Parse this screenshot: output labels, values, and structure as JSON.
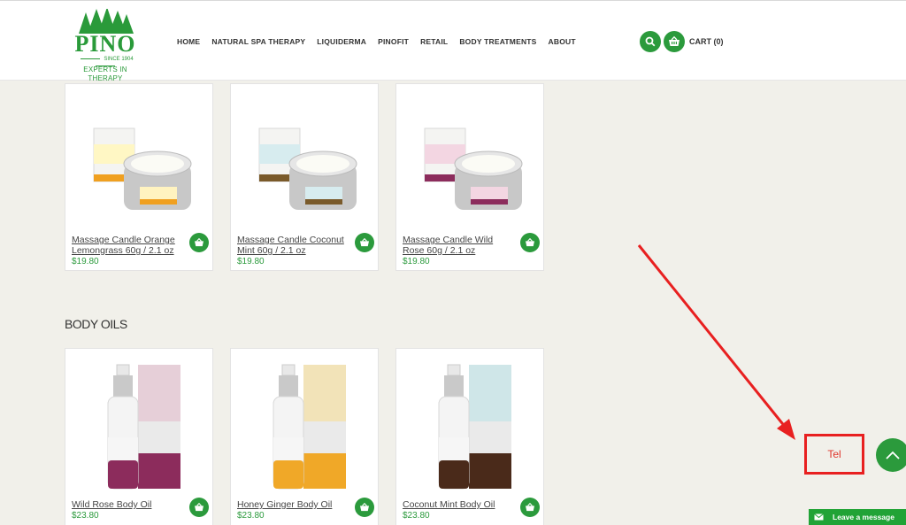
{
  "brand": {
    "name": "PINO",
    "since": "SINCE 1904",
    "tagline": "EXPERTS IN THERAPY",
    "accent_color": "#2b9a3c"
  },
  "nav": {
    "items": [
      "HOME",
      "NATURAL SPA THERAPY",
      "LIQUIDERMA",
      "PINOFIT",
      "RETAIL",
      "BODY TREATMENTS",
      "ABOUT"
    ]
  },
  "header": {
    "cart_label": "CART (0)",
    "search_icon": "search-icon",
    "cart_icon": "cart-icon"
  },
  "candles": [
    {
      "title": "Massage Candle Orange Lemongrass 60g / 2.1 oz",
      "price": "$19.80",
      "accent": "#f0a020"
    },
    {
      "title": "Massage Candle Coconut Mint 60g / 2.1 oz",
      "price": "$19.80",
      "accent": "#7a5a2a"
    },
    {
      "title": "Massage Candle Wild Rose 60g / 2.1 oz",
      "price": "$19.80",
      "accent": "#8c2c5c"
    }
  ],
  "body_oils": {
    "heading": "BODY OILS",
    "items": [
      {
        "title": "Wild Rose Body Oil",
        "price": "$23.80",
        "accent": "#8c2c5c",
        "box": "#e6cfd8"
      },
      {
        "title": "Honey Ginger Body Oil",
        "price": "$23.80",
        "accent": "#f0a828",
        "box": "#f2e3b8"
      },
      {
        "title": "Coconut Mint Body Oil",
        "price": "$23.80",
        "accent": "#4a2a1a",
        "box": "#cfe6e8"
      }
    ]
  },
  "floating": {
    "tel_label": "Tel",
    "leave_message": "Leave a message",
    "scroll_top_icon": "chevron-up-icon"
  }
}
